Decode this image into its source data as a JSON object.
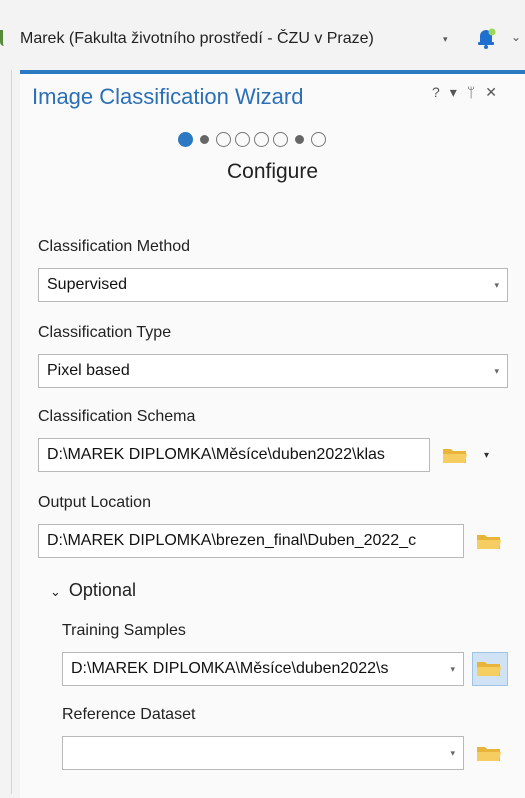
{
  "top_bar": {
    "user_text": "Marek (Fakulta životního prostředí - ČZU v Praze)",
    "caret": "▾",
    "menu_caret": "⌄"
  },
  "wizard": {
    "title": "Image Classification Wizard",
    "controls": {
      "help": "?",
      "menu": "▾",
      "pin": "ᛘ",
      "close": "✕"
    },
    "steps": {
      "current": 1,
      "total": 8
    },
    "current_step_label": "Configure"
  },
  "form": {
    "classification_method": {
      "label": "Classification Method",
      "value": "Supervised"
    },
    "classification_type": {
      "label": "Classification Type",
      "value": "Pixel based"
    },
    "classification_schema": {
      "label": "Classification Schema",
      "value": "D:\\MAREK DIPLOMKA\\Měsíce\\duben2022\\klas"
    },
    "output_location": {
      "label": "Output Location",
      "value": "D:\\MAREK DIPLOMKA\\brezen_final\\Duben_2022_c"
    },
    "optional": {
      "header": "Optional",
      "training_samples": {
        "label": "Training Samples",
        "value": "D:\\MAREK DIPLOMKA\\Měsíce\\duben2022\\s"
      },
      "reference_dataset": {
        "label": "Reference Dataset",
        "value": ""
      }
    }
  },
  "icons": {
    "dropdown": "▾",
    "chevron": "⌄"
  },
  "colors": {
    "accent": "#2b79c2",
    "folder": "#f2c54e"
  }
}
